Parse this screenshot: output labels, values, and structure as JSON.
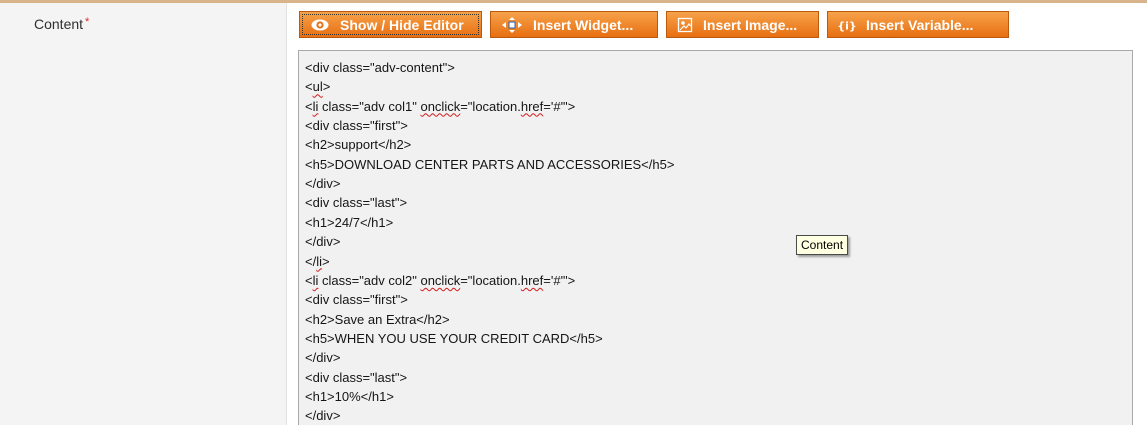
{
  "field": {
    "label": "Content",
    "required_mark": "*"
  },
  "toolbar": {
    "show_hide_label": "Show / Hide Editor",
    "widget_label": "Insert Widget...",
    "image_label": "Insert Image...",
    "variable_label": "Insert Variable...",
    "button_color": "#f18a2c"
  },
  "editor": {
    "lines": [
      [
        {
          "t": "<div class=\"adv-content\">"
        }
      ],
      [
        {
          "t": "<"
        },
        {
          "t": "ul",
          "s": true
        },
        {
          "t": ">"
        }
      ],
      [
        {
          "t": "<"
        },
        {
          "t": "li",
          "s": true
        },
        {
          "t": " class=\"adv col1\" "
        },
        {
          "t": "onclick",
          "s": true
        },
        {
          "t": "=\"location."
        },
        {
          "t": "href",
          "s": true
        },
        {
          "t": "='#'\">"
        }
      ],
      [
        {
          "t": "<div class=\"first\">"
        }
      ],
      [
        {
          "t": "<h2>support</h2>"
        }
      ],
      [
        {
          "t": "<h5>DOWNLOAD CENTER PARTS AND ACCESSORIES</h5>"
        }
      ],
      [
        {
          "t": "</div>"
        }
      ],
      [
        {
          "t": "<div class=\"last\">"
        }
      ],
      [
        {
          "t": "<h1>24/7</h1>"
        }
      ],
      [
        {
          "t": "</div>"
        }
      ],
      [
        {
          "t": "</"
        },
        {
          "t": "li",
          "s": true
        },
        {
          "t": ">"
        }
      ],
      [
        {
          "t": "<"
        },
        {
          "t": "li",
          "s": true
        },
        {
          "t": " class=\"adv col2\" "
        },
        {
          "t": "onclick",
          "s": true
        },
        {
          "t": "=\"location."
        },
        {
          "t": "href",
          "s": true
        },
        {
          "t": "='#'\">"
        }
      ],
      [
        {
          "t": "<div class=\"first\">"
        }
      ],
      [
        {
          "t": "<h2>Save an Extra</h2>"
        }
      ],
      [
        {
          "t": "<h5>WHEN YOU USE YOUR CREDIT CARD</h5>"
        }
      ],
      [
        {
          "t": "</div>"
        }
      ],
      [
        {
          "t": "<div class=\"last\">"
        }
      ],
      [
        {
          "t": "<h1>10%</h1>"
        }
      ],
      [
        {
          "t": "</div>"
        }
      ]
    ]
  },
  "tooltip": {
    "text": "Content"
  }
}
